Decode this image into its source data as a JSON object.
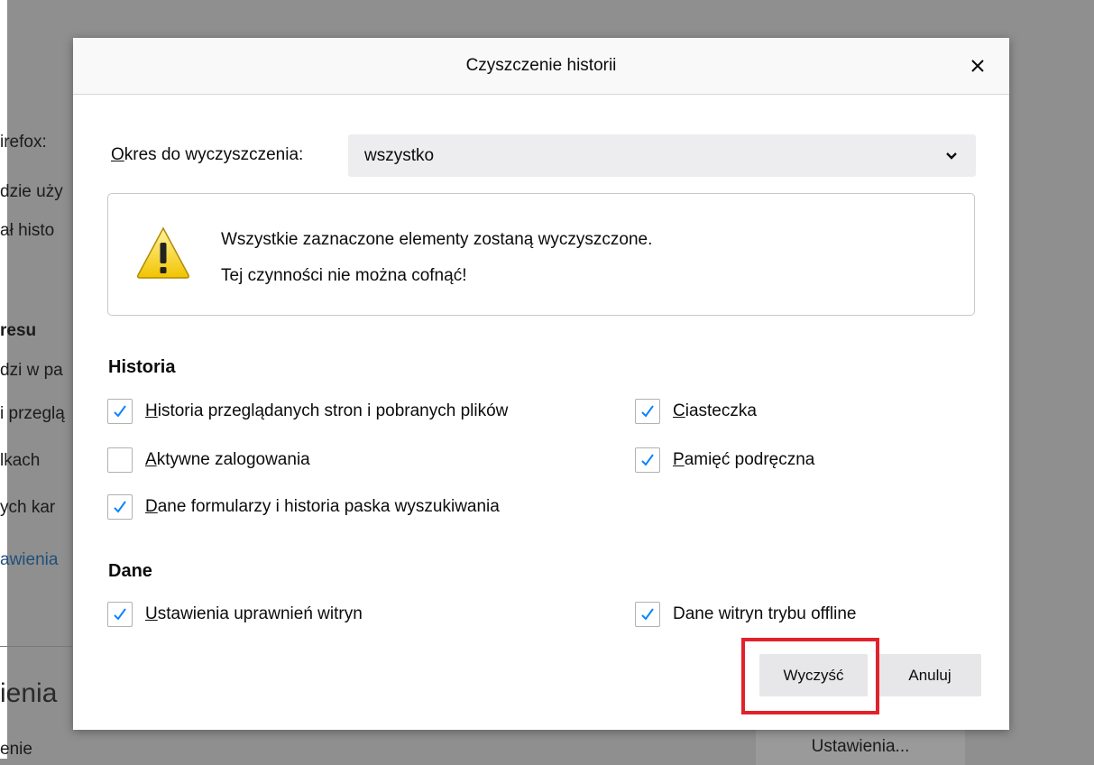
{
  "background": {
    "fragments": [
      "irefox:",
      "dzie uży",
      "ał histo",
      "resu",
      "dzi w pa",
      "i przeglą",
      "lkach",
      "ych kar",
      "awienia",
      "ienia",
      "enie"
    ],
    "settings_button": "Ustawienia..."
  },
  "dialog": {
    "title": "Czyszczenie historii",
    "close_glyph": "×",
    "period": {
      "label": "Okres do wyczyszczenia:",
      "selected": "wszystko"
    },
    "warning": {
      "line1": "Wszystkie zaznaczone elementy zostaną wyczyszczone.",
      "line2": "Tej czynności nie można cofnąć!"
    },
    "history_section": {
      "heading": "Historia",
      "items": [
        {
          "label": "Historia przeglądanych stron i pobranych plików",
          "checked": true
        },
        {
          "label": "Ciasteczka",
          "checked": true
        },
        {
          "label": "Aktywne zalogowania",
          "checked": false
        },
        {
          "label": "Pamięć podręczna",
          "checked": true
        },
        {
          "label": "Dane formularzy i historia paska wyszukiwania",
          "checked": true
        }
      ]
    },
    "data_section": {
      "heading": "Dane",
      "items": [
        {
          "label": "Ustawienia uprawnień witryn",
          "checked": true
        },
        {
          "label": "Dane witryn trybu offline",
          "checked": true
        }
      ]
    },
    "buttons": {
      "clear": "Wyczyść",
      "cancel": "Anuluj"
    }
  },
  "colors": {
    "highlight": "#e2222b",
    "checkmark": "#0a84ff",
    "warning_yellow": "#f5d800"
  }
}
